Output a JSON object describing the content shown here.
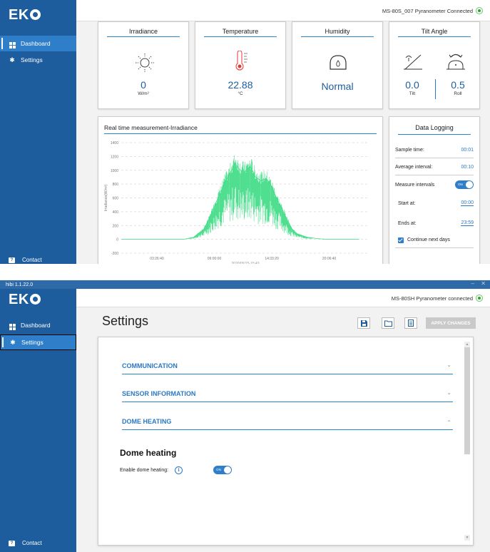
{
  "top": {
    "brand": "EK",
    "nav": {
      "dashboard": "Dashboard",
      "settings": "Settings",
      "contact": "Contact"
    },
    "connection": "MS-80S_007 Pyranometer Connected",
    "cards": {
      "irradiance": {
        "title": "Irradiance",
        "value": "0",
        "unit": "W/m²"
      },
      "temperature": {
        "title": "Temperature",
        "value": "22.88",
        "unit": "°C"
      },
      "humidity": {
        "title": "Humidity",
        "value": "Normal"
      },
      "tilt": {
        "title": "Tilt Angle",
        "tilt_value": "0.0",
        "tilt_label": "Tilt",
        "roll_value": "0.5",
        "roll_label": "Roll"
      }
    },
    "chart_title": "Real time measurement-Irradiance",
    "data_logging": {
      "title": "Data Logging",
      "sample_time_label": "Sample time:",
      "sample_time": "00:01",
      "avg_interval_label": "Average interval:",
      "avg_interval": "00:10",
      "measure_intervals_label": "Measure intervals",
      "toggle_on": "ON",
      "start_label": "Start at:",
      "start": "00:00",
      "end_label": "Ends at:",
      "end": "23:59",
      "continue_label": "Continue next days"
    }
  },
  "chart_data": {
    "type": "line",
    "title": "Real time measurement-Irradiance",
    "ylabel": "Irradiance(W/m²)",
    "xlabel": "",
    "ylim": [
      -200,
      1400
    ],
    "yticks": [
      "1400",
      "1200",
      "1000",
      "800",
      "600",
      "400",
      "200",
      "0",
      "-200"
    ],
    "xticks": [
      "03:26:40",
      "09:00:00",
      "14:33:20",
      "20:06:40"
    ],
    "x_caption": "2020/05/15-15:43",
    "grid": true,
    "series": [
      {
        "color": "#3ddc84",
        "x": [
          "00:00",
          "06:00",
          "07:00",
          "08:00",
          "08:30",
          "09:00",
          "09:30",
          "10:00",
          "10:30",
          "11:00",
          "11:30",
          "12:00",
          "12:30",
          "13:00",
          "13:30",
          "14:00",
          "14:30",
          "15:00",
          "15:30",
          "16:00",
          "16:30",
          "17:00",
          "18:00",
          "19:00",
          "20:00",
          "23:00"
        ],
        "values": [
          0,
          0,
          30,
          150,
          300,
          480,
          650,
          820,
          950,
          1100,
          1000,
          980,
          1050,
          900,
          850,
          880,
          780,
          600,
          450,
          300,
          150,
          80,
          30,
          10,
          0,
          0
        ]
      }
    ]
  },
  "bottom": {
    "window_title": "hibi 1.1.22.0",
    "brand": "EK",
    "nav": {
      "dashboard": "Dashboard",
      "settings": "Settings",
      "contact": "Contact"
    },
    "connection": "MS-80SH Pyranometer connected",
    "page_title": "Settings",
    "apply_label": "APPLY CHANGES",
    "sections": [
      "COMMUNICATION",
      "SENSOR INFORMATION",
      "DOME HEATING"
    ],
    "dome_heading": "Dome heating",
    "enable_label": "Enable dome heating:",
    "info_glyph": "i",
    "toggle_on": "ON"
  }
}
